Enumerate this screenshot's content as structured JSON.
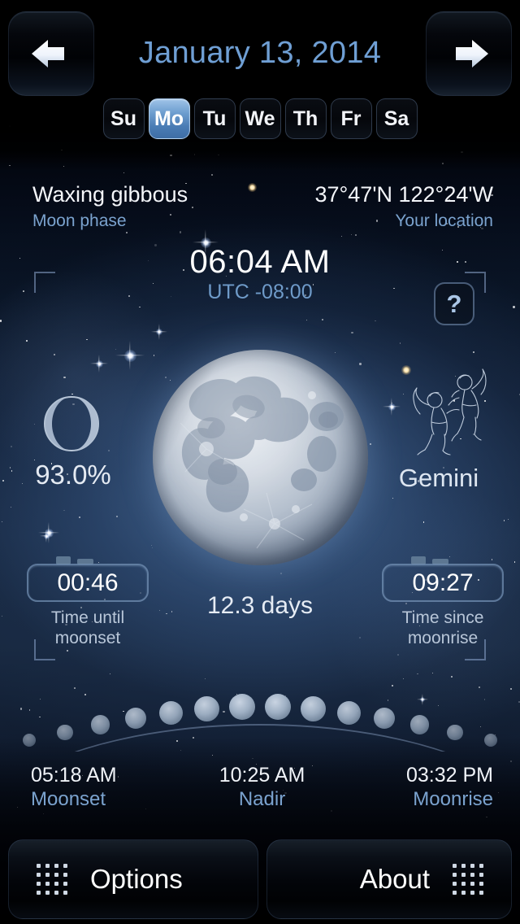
{
  "header": {
    "prev_label": "previous day",
    "next_label": "next day",
    "date": "January 13, 2014",
    "weekdays": [
      {
        "label": "Su",
        "selected": false
      },
      {
        "label": "Mo",
        "selected": true
      },
      {
        "label": "Tu",
        "selected": false
      },
      {
        "label": "We",
        "selected": false
      },
      {
        "label": "Th",
        "selected": false
      },
      {
        "label": "Fr",
        "selected": false
      },
      {
        "label": "Sa",
        "selected": false
      }
    ]
  },
  "info": {
    "phase_value": "Waxing gibbous",
    "phase_label": "Moon phase",
    "location_value": "37°47'N 122°24'W",
    "location_label": "Your location",
    "clock_time": "06:04 AM",
    "clock_timezone": "UTC -08:00",
    "help_label": "?"
  },
  "moon": {
    "illumination": "93.0%",
    "age": "12.3 days",
    "constellation": "Gemini"
  },
  "timers": {
    "left": {
      "value": "00:46",
      "caption_line1": "Time until",
      "caption_line2": "moonset"
    },
    "right": {
      "value": "09:27",
      "caption_line1": "Time since",
      "caption_line2": "moonrise"
    }
  },
  "times": [
    {
      "value": "05:18 AM",
      "label": "Moonset"
    },
    {
      "value": "10:25 AM",
      "label": "Nadir"
    },
    {
      "value": "03:32 PM",
      "label": "Moonrise"
    }
  ],
  "toolbar": {
    "options_label": "Options",
    "about_label": "About"
  },
  "colors": {
    "accent_blue": "#6f9fd4",
    "label_blue": "#7ba3cf",
    "text_white": "#f4f6fa",
    "selected_day": "#4a7cb4",
    "sky_deep": "#1b2f4b"
  }
}
